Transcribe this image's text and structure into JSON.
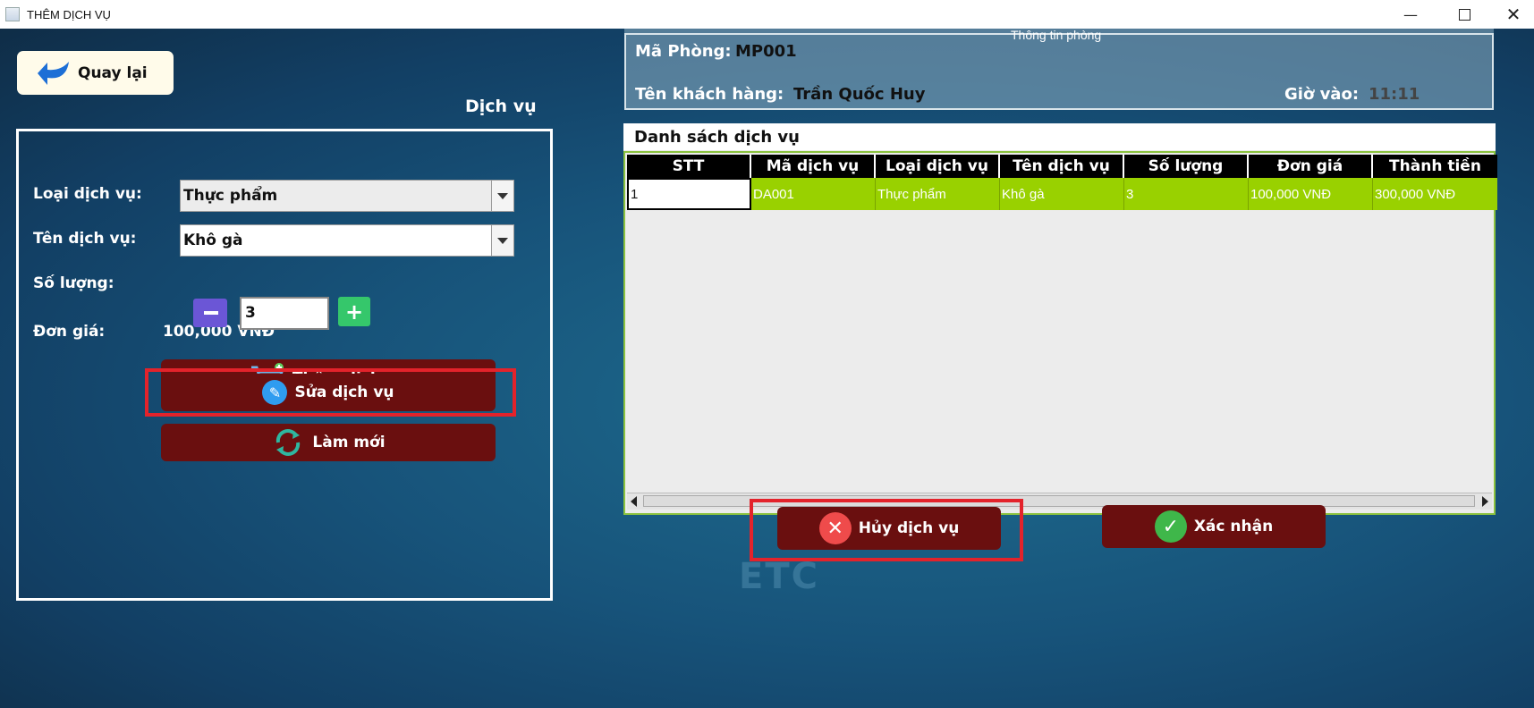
{
  "window": {
    "title": "THÊM DỊCH VỤ"
  },
  "left": {
    "back_label": "Quay lại",
    "section_title": "Dịch vụ",
    "service_type_label": "Loại dịch vụ:",
    "service_type_value": "Thực phẩm",
    "service_name_label": "Tên dịch vụ:",
    "service_name_value": "Khô gà",
    "quantity_label": "Số lượng:",
    "quantity_value": "3",
    "price_label": "Đơn giá:",
    "price_value": "100,000 VNĐ",
    "add_label": "Thêm dịch vụ",
    "edit_label": "Sửa dịch vụ",
    "refresh_label": "Làm mới"
  },
  "room": {
    "legend": "Thông tin phòng",
    "room_id_label": "Mã Phòng:",
    "room_id_value": "MP001",
    "customer_label": "Tên khách hàng:",
    "customer_value": "Trần Quốc Huy",
    "checkin_label": "Giờ vào:",
    "checkin_value": "11:11"
  },
  "table": {
    "caption": "Danh sách dịch vụ",
    "columns": [
      "STT",
      "Mã dịch vụ",
      "Loại dịch vụ",
      "Tên dịch vụ",
      "Số lượng",
      "Đơn giá",
      "Thành tiền"
    ],
    "rows": [
      [
        "1",
        "DA001",
        "Thực phẩm",
        "Khô gà",
        "3",
        "100,000 VNĐ",
        "300,000 VNĐ"
      ]
    ]
  },
  "actions": {
    "cancel_label": "Hủy dịch vụ",
    "confirm_label": "Xác nhận"
  },
  "colors": {
    "button_dark_red": "#6a0f0f",
    "highlight_red": "#e3232b",
    "selected_row": "#99d100",
    "background_blue": "#17537a"
  }
}
